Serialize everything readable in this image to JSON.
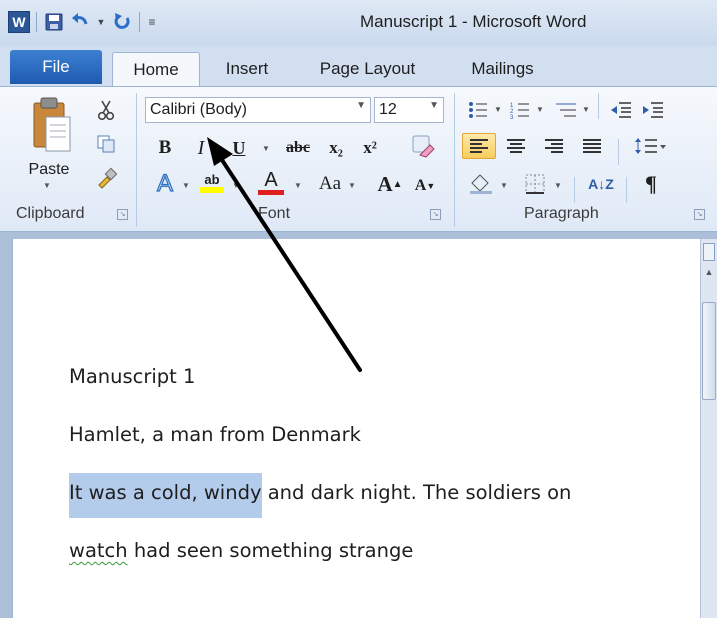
{
  "window": {
    "title": "Manuscript 1  -  Microsoft Word",
    "app_logo": "W"
  },
  "quick_access": {
    "icons": [
      "word-icon",
      "save-icon",
      "undo-icon",
      "redo-icon",
      "customize-toolbar-icon"
    ]
  },
  "tabs": [
    {
      "label": "File"
    },
    {
      "label": "Home",
      "active": true
    },
    {
      "label": "Insert"
    },
    {
      "label": "Page Layout"
    },
    {
      "label": "Mailings"
    }
  ],
  "ribbon": {
    "clipboard": {
      "label": "Clipboard",
      "paste_label": "Paste",
      "icons": [
        "paste-icon",
        "cut-icon",
        "copy-icon",
        "format-painter-icon"
      ]
    },
    "font": {
      "label": "Font",
      "font_name": "Calibri (Body)",
      "font_size": "12",
      "bold": "B",
      "italic": "I",
      "underline": "U",
      "strikethrough": "abc",
      "subscript": "x₂",
      "superscript": "x²",
      "text_effects": "A",
      "highlight": "ab",
      "font_color": "A",
      "change_case": "Aa",
      "grow": "A",
      "shrink": "A",
      "highlight_color": "#ffff00",
      "font_color_value": "#e02020"
    },
    "paragraph": {
      "label": "Paragraph",
      "show_marks": "¶",
      "sort": "A↓Z",
      "active_alignment": "align-left"
    }
  },
  "document": {
    "lines": [
      {
        "text": "Manuscript 1"
      },
      {
        "text": "Hamlet, a man from Denmark"
      },
      {
        "selected": "It was a cold, windy",
        "rest": " and dark night. The soldiers on"
      },
      {
        "squiggle": "watch",
        "rest": " had seen something strange"
      }
    ]
  },
  "colors": {
    "selection": "#b3cceb",
    "ribbon_bg": "#dfe9f6",
    "accent": "#2b5797"
  }
}
